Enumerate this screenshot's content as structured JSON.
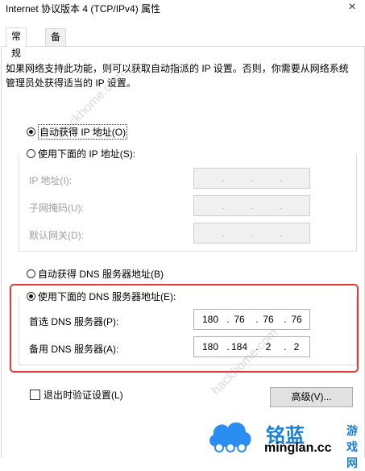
{
  "window": {
    "title": "Internet 协议版本 4 (TCP/IPv4) 属性",
    "close_symbol": "×"
  },
  "tabs": [
    {
      "label": "常规"
    },
    {
      "label": "备用配置"
    }
  ],
  "description": "如果网络支持此功能，则可以获取自动指派的 IP 设置。否则，你需要从网络系统管理员处获得适当的 IP 设置。",
  "ip": {
    "auto_label": "自动获得 IP 地址(O)",
    "manual_label": "使用下面的 IP 地址(S):",
    "fields": [
      {
        "label": "IP 地址(I):",
        "value": [
          ".",
          ".",
          "."
        ]
      },
      {
        "label": "子网掩码(U):",
        "value": [
          ".",
          ".",
          "."
        ]
      },
      {
        "label": "默认网关(D):",
        "value": [
          ".",
          ".",
          "."
        ]
      }
    ]
  },
  "dns": {
    "auto_label": "自动获得 DNS 服务器地址(B)",
    "manual_label": "使用下面的 DNS 服务器地址(E):",
    "preferred_label": "首选 DNS 服务器(P):",
    "alternate_label": "备用 DNS 服务器(A):",
    "preferred_value": [
      "180",
      ".",
      "76",
      ".",
      "76",
      ".",
      "76"
    ],
    "alternate_value": [
      "180",
      ".",
      "184",
      ".",
      "2",
      ".",
      "2"
    ]
  },
  "footer": {
    "validate_label": "退出时验证设置(L)",
    "advanced_label": "高级(V)..."
  },
  "watermarks": [
    "hackhome.com",
    "hackhome.com"
  ],
  "logo": {
    "brand": "铭蓝",
    "brand2": "游戏网",
    "domain": "minglan.cc"
  },
  "colors": {
    "highlight": "#e53935",
    "brand": "#1a7fd6"
  }
}
